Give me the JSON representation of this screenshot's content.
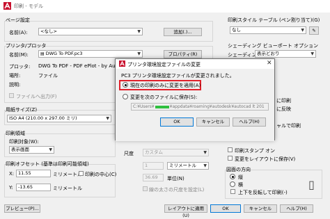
{
  "window": {
    "title": "印刷 - モデル"
  },
  "dialog": {
    "title": "プリンタ環境設定ファイルの変更",
    "message": "PC3 プリンタ環境設定ファイルが変更されました。",
    "option_current": "現在の印刷のみに変更を適用(A)",
    "option_save": "変更を次のファイルに保存(S):",
    "path_prefix": "C:¥Users¥",
    "path_suffix": "¥appdata¥roaming¥autodesk¥autocad lt 201",
    "ok": "OK",
    "cancel": "キャンセル",
    "help": "ヘルプ(H)"
  },
  "page_setup": {
    "group": "ページ設定",
    "name_label": "名前(A):",
    "name_value": "<なし>",
    "add_button": "追加(.)..."
  },
  "printer": {
    "group": "プリンタ/プロッタ",
    "name_label": "名前(M):",
    "name_value": "DWG To PDF.pc3",
    "properties_button": "プロパティ(R)",
    "plotter_label": "プロッタ:",
    "plotter_value": "DWG To PDF - PDF ePlot - by Autodesk",
    "location_label": "場所:",
    "location_value": "ファイル",
    "description_label": "説明:",
    "plot_to_file": "ファイルへ出力(F)"
  },
  "paper": {
    "group": "用紙サイズ(Z)",
    "value": "ISO A4 (210.00 x 297.00 ミリ)"
  },
  "area": {
    "group": "印刷領域",
    "what_label": "印刷対象(W):",
    "what_value": "表示画面"
  },
  "offset": {
    "group": "印刷オフセット (基準は印刷可能領域)",
    "x_label": "X:",
    "x_value": "11.55",
    "x_unit": "ミリメートル",
    "center": "印刷の中心(C)",
    "y_label": "Y:",
    "y_value": "-13.65",
    "y_unit": "ミリメートル"
  },
  "scale": {
    "label": "尺度",
    "value": "カスタム",
    "unit_count": "1",
    "unit1": "ミリメートル",
    "drawing_units": "36.69",
    "unit2": "単位(N)",
    "lineweights": "線の太さの尺度を設定(L)"
  },
  "style_table": {
    "group": "印刷スタイル テーブル (ペン割り当て)(G)",
    "value": "なし"
  },
  "shaded": {
    "group": "シェーディング ビューポート オプション",
    "label": "シェーディング(D)",
    "value": "表示どおり"
  },
  "options": {
    "partial1": "に印刷",
    "partial2": "に反映",
    "partial3": "ャルで印刷",
    "stamp": "印刷スタンプ オン",
    "save_changes": "変更をレイアウトに保存(V)"
  },
  "orientation": {
    "group": "図面の方向",
    "portrait": "縦",
    "landscape": "横",
    "upside_down": "上下を反転して印刷(-)"
  },
  "footer": {
    "preview": "プレビュー(P)...",
    "apply_layout": "レイアウトに適用(U)",
    "ok": "OK",
    "cancel": "キャンセル",
    "help": "ヘルプ(H)"
  }
}
